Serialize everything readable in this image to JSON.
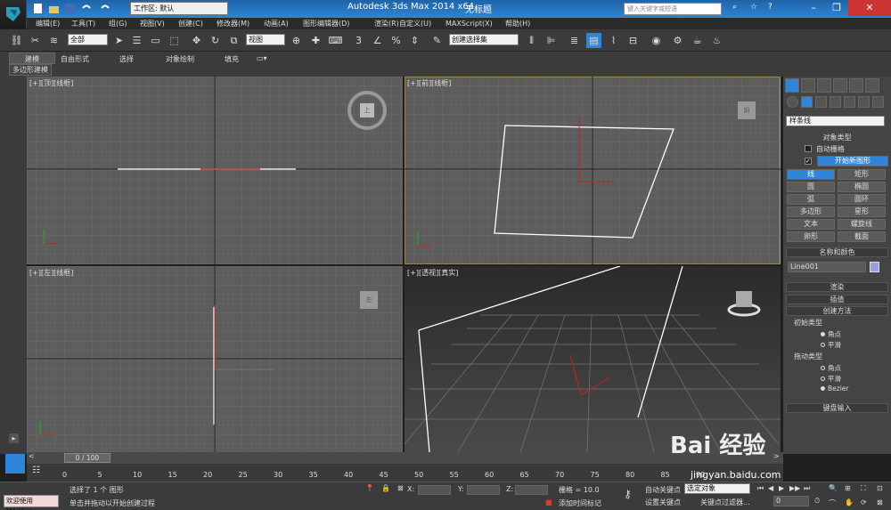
{
  "titlebar": {
    "workspace_label": "工作区: 默认",
    "app_title": "Autodesk 3ds Max  2014 x64",
    "doc_title": "无标题",
    "search_placeholder": "键入关键字或短语"
  },
  "menu": [
    "编辑(E)",
    "工具(T)",
    "组(G)",
    "视图(V)",
    "创建(C)",
    "修改器(M)",
    "动画(A)",
    "图形编辑器(D)",
    "渲染(R)",
    "自定义(U)",
    "MAXScript(X)",
    "帮助(H)"
  ],
  "toolbar": {
    "selection_filter": "全部",
    "ref_coord": "视图",
    "named_selection": "创建选择集"
  },
  "ribbon": {
    "tabs": [
      "建模",
      "自由形式",
      "选择",
      "对象绘制",
      "填充"
    ],
    "sub_label": "多边形建模"
  },
  "viewports": {
    "top": "[+][顶][线框]",
    "front": "[+][前][线框]",
    "left": "[+][左][线框]",
    "persp": "[+][透视][真实]",
    "viewcube_top": "上",
    "viewcube_front": "前",
    "viewcube_left": "左"
  },
  "cmdpanel": {
    "category": "样条线",
    "object_type_title": "对象类型",
    "auto_grid": "自动栅格",
    "start_new_shape": "开始新图形",
    "buttons": [
      [
        "线",
        "矩形"
      ],
      [
        "圆",
        "椭圆"
      ],
      [
        "弧",
        "圆环"
      ],
      [
        "多边形",
        "星形"
      ],
      [
        "文本",
        "螺旋线"
      ],
      [
        "卵形",
        "截面"
      ]
    ],
    "name_color_title": "名称和颜色",
    "object_name": "Line001",
    "render_title": "渲染",
    "interp_title": "插值",
    "creation_title": "创建方法",
    "initial_type": "初始类型",
    "initial_opts": [
      "角点",
      "平滑"
    ],
    "drag_type": "拖动类型",
    "drag_opts": [
      "角点",
      "平滑",
      "Bezier"
    ],
    "keyboard_title": "键盘输入"
  },
  "timeline": {
    "frame_label": "0 / 100",
    "ticks": [
      "0",
      "5",
      "10",
      "15",
      "20",
      "25",
      "30",
      "35",
      "40",
      "45",
      "50",
      "55",
      "60",
      "65",
      "70",
      "75",
      "80",
      "85",
      "90"
    ]
  },
  "status": {
    "maxscript": "欢迎使用 MAXScr",
    "selected": "选择了 1 个 图形",
    "prompt": "单击并拖动以开始创建过程",
    "x_label": "X:",
    "y_label": "Y:",
    "z_label": "Z:",
    "grid": "栅格 = 10.0",
    "add_time_tag": "添加时间标记",
    "auto_key": "自动关键点",
    "set_key": "设置关键点",
    "selected_obj": "选定对象",
    "key_filters": "关键点过滤器...",
    "frame_value": "0"
  },
  "watermark": {
    "text": "Bai 经验",
    "url": "jingyan.baidu.com"
  },
  "colors": {
    "accent": "#2f86d8",
    "viewport_bg": "#5d5d5d",
    "active_border": "#c9a640",
    "x_axis": "#c22",
    "titlebar": "#2e86d3"
  }
}
